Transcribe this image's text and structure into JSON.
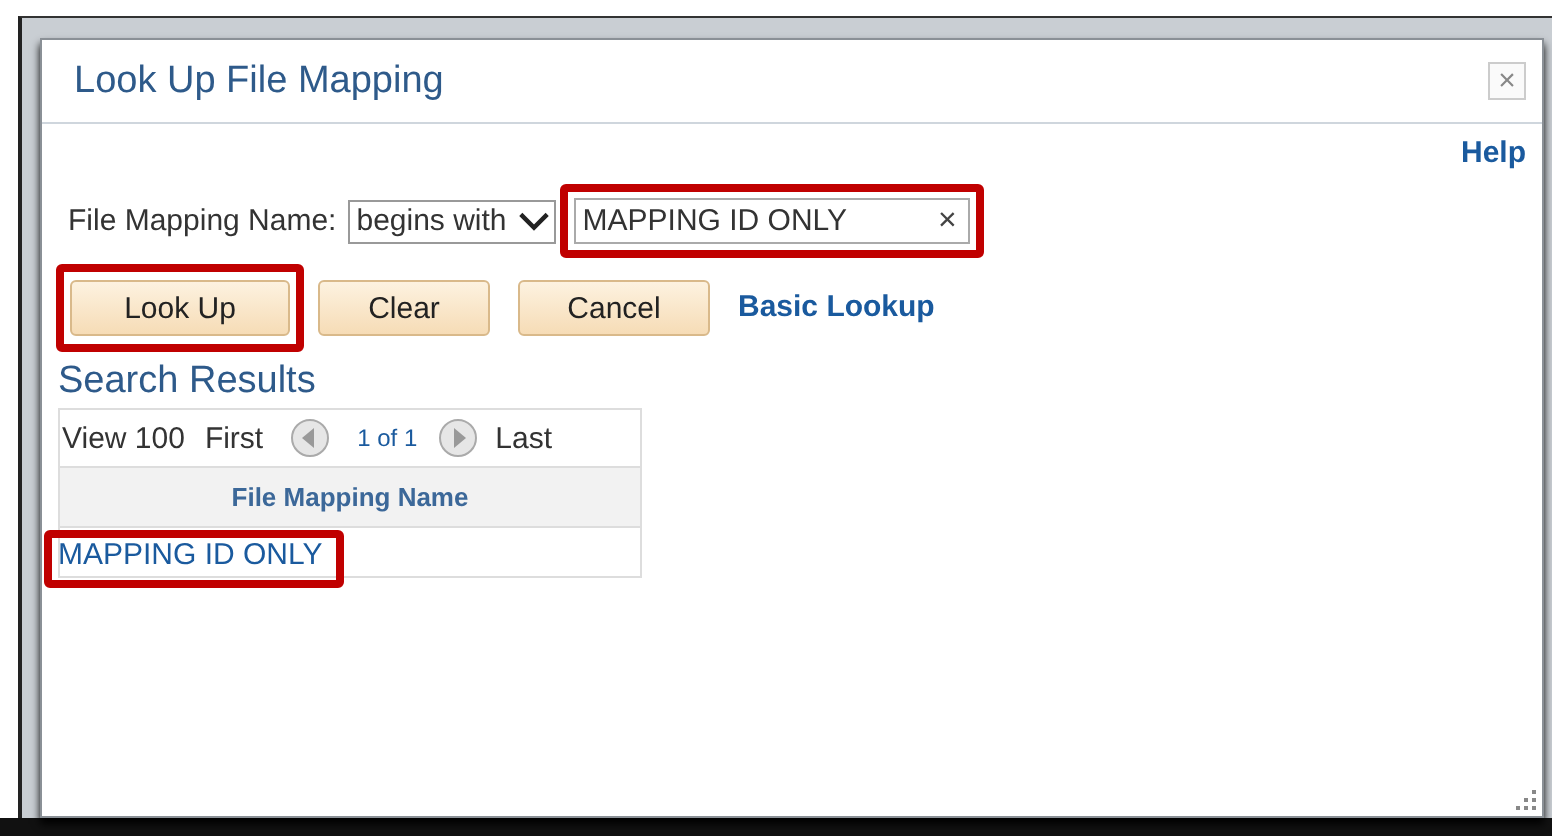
{
  "dialog": {
    "title": "Look Up File Mapping",
    "close": "×",
    "help": "Help"
  },
  "filter": {
    "label": "File Mapping Name:",
    "operator": "begins with",
    "value": "MAPPING ID ONLY",
    "clear": "×",
    "highlighted": true
  },
  "buttons": [
    {
      "label": "Look Up",
      "kind": "button",
      "highlighted": true
    },
    {
      "label": "Clear",
      "kind": "button",
      "highlighted": false
    },
    {
      "label": "Cancel",
      "kind": "button",
      "highlighted": false
    },
    {
      "label": "Basic Lookup",
      "kind": "link",
      "highlighted": false
    }
  ],
  "results": {
    "title": "Search Results",
    "nav": {
      "view": "View 100",
      "first": "First",
      "pages": "1 of 1",
      "last": "Last"
    },
    "columns": [
      "File Mapping Name"
    ],
    "rows": [
      {
        "cells": [
          "MAPPING ID ONLY"
        ],
        "highlighted": true
      }
    ]
  }
}
